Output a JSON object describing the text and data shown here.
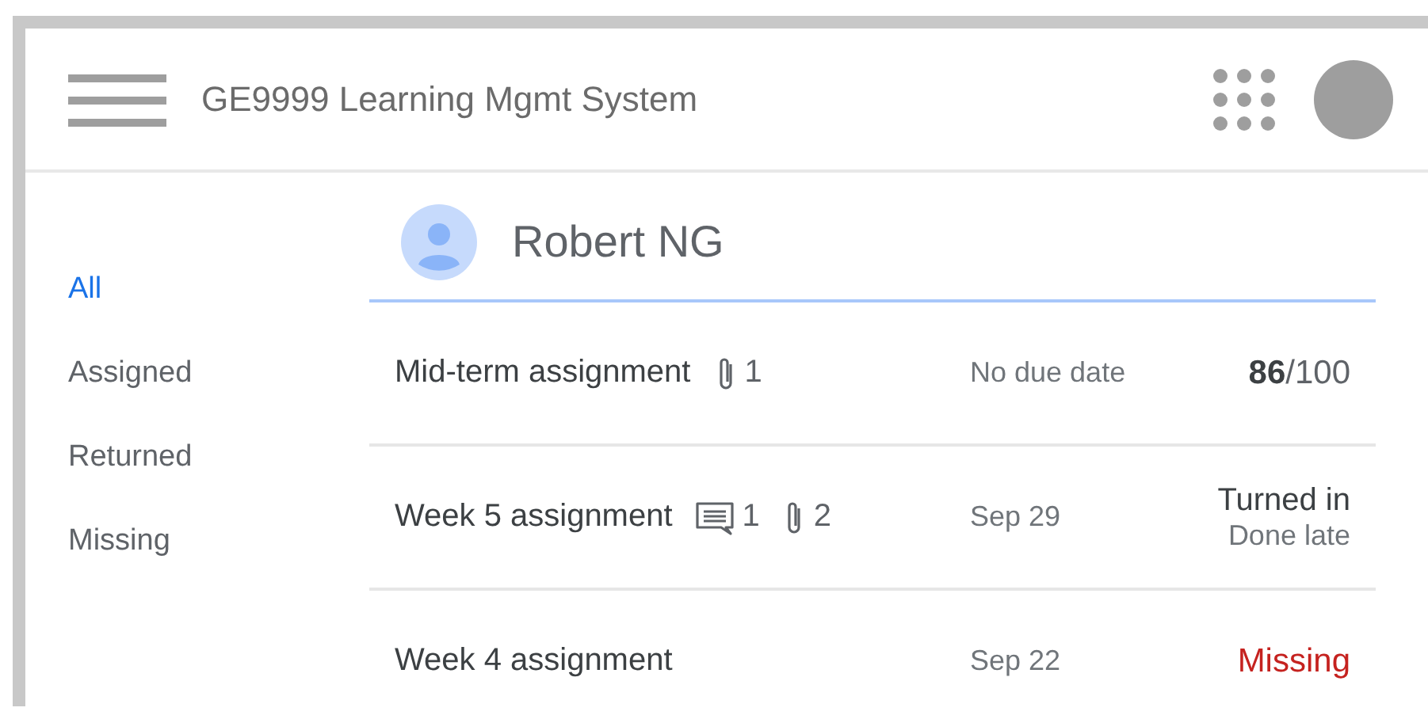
{
  "app_bar": {
    "title": "GE9999 Learning Mgmt System"
  },
  "sidebar": {
    "items": [
      {
        "label": "All",
        "selected": true
      },
      {
        "label": "Assigned",
        "selected": false
      },
      {
        "label": "Returned",
        "selected": false
      },
      {
        "label": "Missing",
        "selected": false
      }
    ]
  },
  "student": {
    "name": "Robert NG"
  },
  "assignments": [
    {
      "title": "Mid-term assignment",
      "attachments": "1",
      "due": "No due date",
      "status": {
        "kind": "graded",
        "text": "**86**/100"
      }
    },
    {
      "title": "Week 5 assignment",
      "comments": "1",
      "attachments": "2",
      "due": "Sep 29",
      "status": {
        "kind": "turned_in",
        "text": "Turned in",
        "note": "Done late"
      }
    },
    {
      "title": "Week 4 assignment",
      "due": "Sep 22",
      "status": {
        "kind": "missing",
        "text": "Missing"
      }
    }
  ]
}
